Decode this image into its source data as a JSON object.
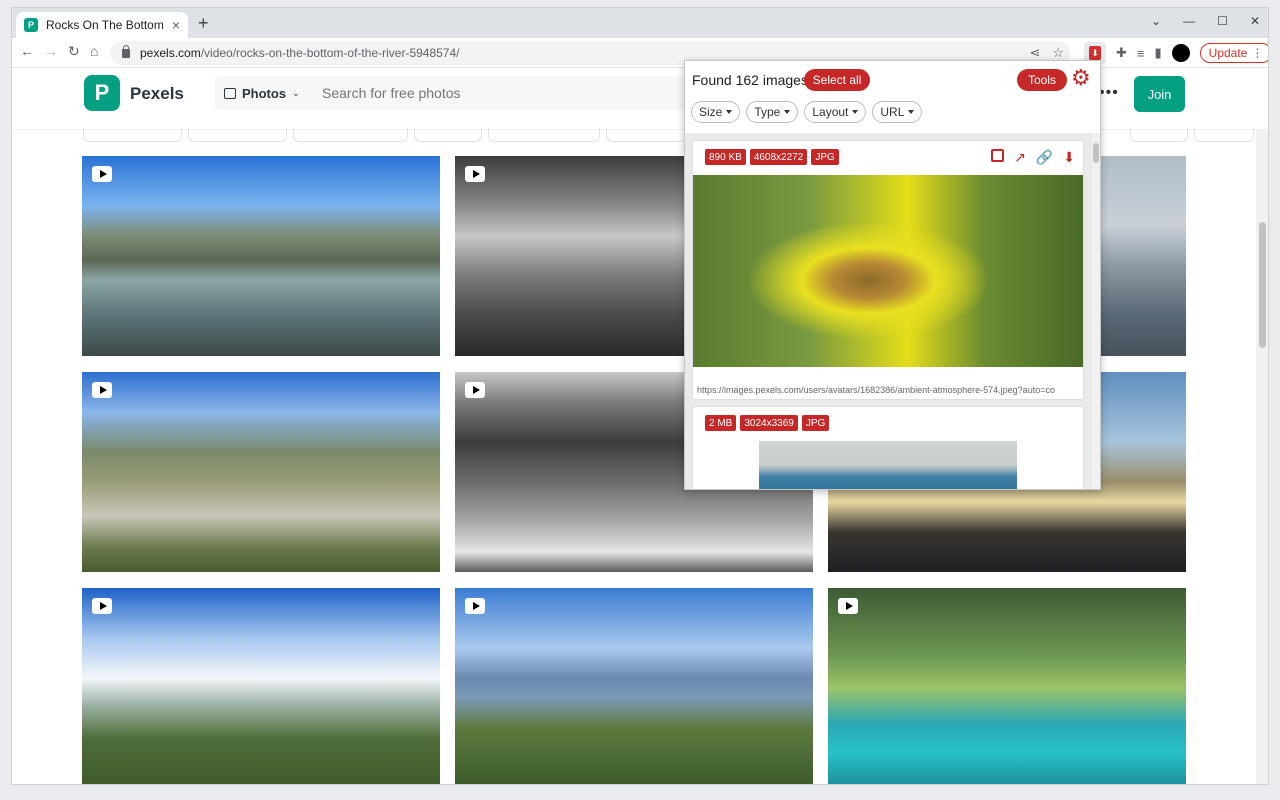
{
  "browser": {
    "tab_title": "Rocks On The Bottom Of",
    "tab_favicon": "pexels-favicon",
    "url_host": "pexels.com",
    "url_path": "/video/rocks-on-the-bottom-of-the-river-5948574/",
    "update_label": "Update",
    "icons": [
      "back-icon",
      "forward-icon",
      "reload-icon",
      "home-icon",
      "share-icon",
      "star-icon",
      "extension-icon",
      "puzzle-icon",
      "reading-list-icon",
      "sidepanel-icon"
    ]
  },
  "site": {
    "brand": "Pexels",
    "search_type": "Photos",
    "search_placeholder": "Search for free photos",
    "join_label": "Join",
    "accent_color": "#05a081"
  },
  "popup": {
    "found_text": "Found 162 images",
    "select_all_label": "Select all",
    "tools_label": "Tools",
    "accent_color": "#c62828",
    "filters": [
      "Size",
      "Type",
      "Layout",
      "URL"
    ],
    "items": [
      {
        "size": "890 KB",
        "dimensions": "4608x2272",
        "format": "JPG",
        "url": "https://images.pexels.com/users/avatars/1682386/ambient-atmosphere-574.jpeg?auto=co"
      },
      {
        "size": "2 MB",
        "dimensions": "3024x3369",
        "format": "JPG",
        "url": ""
      }
    ]
  }
}
